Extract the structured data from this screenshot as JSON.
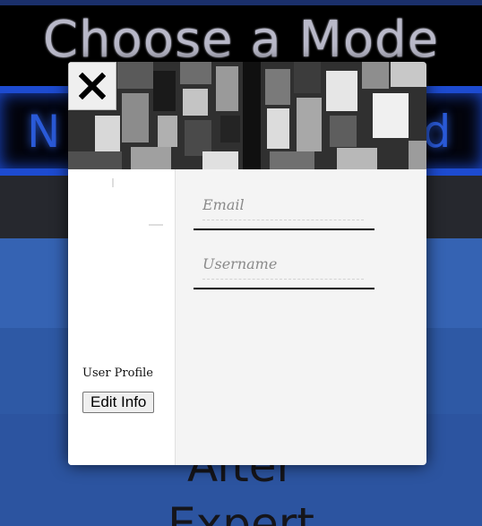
{
  "background": {
    "title": "Choose a Mode",
    "band_left_text": "N",
    "band_right_text": "rd",
    "lower_word": "After",
    "bottom_word": "Expert"
  },
  "modal": {
    "close_icon": "close-icon",
    "profile_label": "User Profile",
    "edit_button_label": "Edit Info",
    "email": {
      "placeholder": "Email",
      "value": ""
    },
    "username": {
      "placeholder": "Username",
      "value": ""
    }
  },
  "colors": {
    "page_blue": "#3563b3",
    "neon_blue": "#1d4bd0",
    "modal_bg": "#f4f4f4"
  }
}
